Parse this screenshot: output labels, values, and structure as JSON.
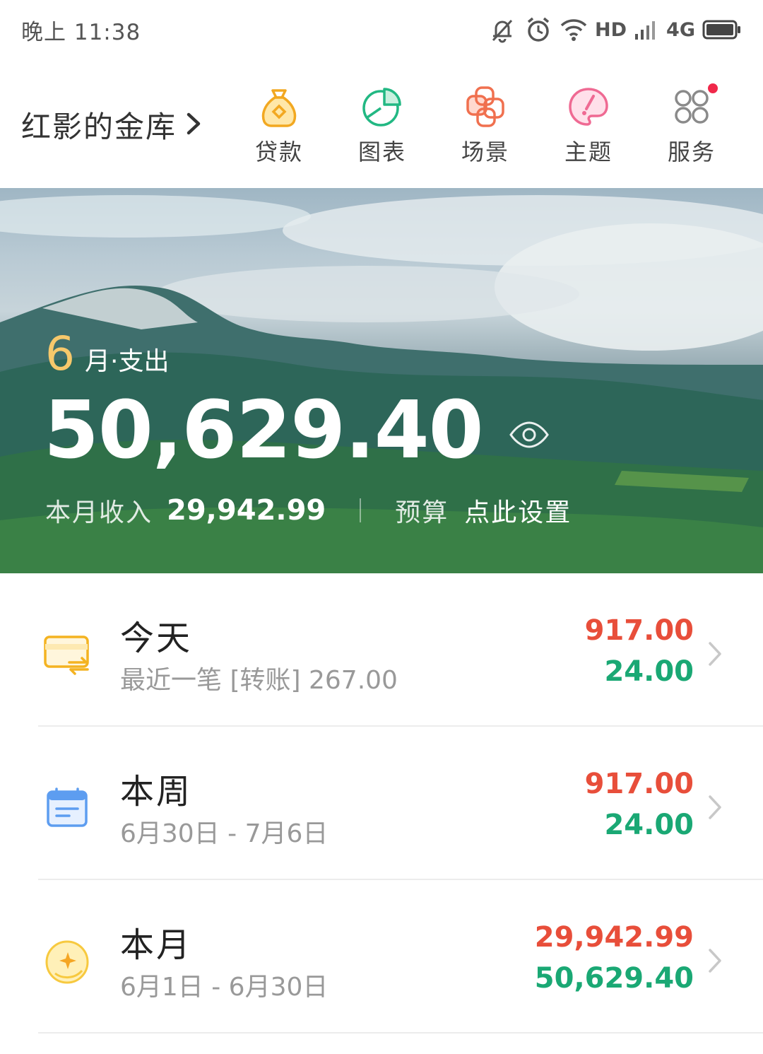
{
  "status_bar": {
    "time": "晚上 11:38",
    "hd": "HD",
    "network": "4G",
    "icons": [
      "mute-bell-icon",
      "alarm-icon",
      "wifi-icon",
      "signal-icon",
      "battery-icon"
    ]
  },
  "header": {
    "account_name": "红影的金库",
    "shortcuts": [
      {
        "label": "贷款",
        "icon": "money-bag-icon"
      },
      {
        "label": "图表",
        "icon": "pie-chart-icon"
      },
      {
        "label": "场景",
        "icon": "scene-knot-icon"
      },
      {
        "label": "主题",
        "icon": "theme-brush-icon"
      },
      {
        "label": "服务",
        "icon": "services-grid-icon",
        "has_badge": true
      }
    ]
  },
  "banner": {
    "month": "6",
    "month_label": "月·支出",
    "expense": "50,629.40",
    "income_label": "本月收入",
    "income": "29,942.99",
    "budget_label": "预算",
    "budget_action": "点此设置"
  },
  "list": [
    {
      "title": "今天",
      "subtitle": "最近一笔 [转账] 267.00",
      "out": "917.00",
      "in": "24.00",
      "icon": "transfer-card-icon"
    },
    {
      "title": "本周",
      "subtitle": "6月30日 - 7月6日",
      "out": "917.00",
      "in": "24.00",
      "icon": "calendar-icon"
    },
    {
      "title": "本月",
      "subtitle": "6月1日 - 6月30日",
      "out": "29,942.99",
      "in": "50,629.40",
      "icon": "moon-icon"
    }
  ],
  "colors": {
    "expense_red": "#e84e3a",
    "income_green": "#1aa874",
    "month_gold": "#f6c86b",
    "badge_red": "#f0284a"
  }
}
